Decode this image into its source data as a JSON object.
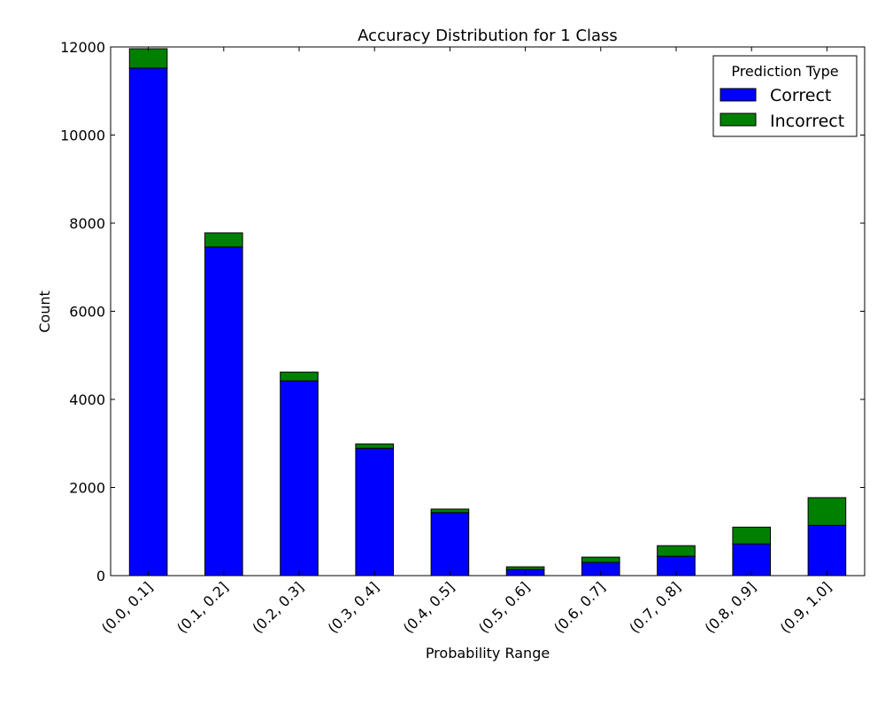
{
  "chart_data": {
    "type": "bar",
    "stacked": true,
    "title": "Accuracy Distribution for 1 Class",
    "xlabel": "Probability Range",
    "ylabel": "Count",
    "ylim": [
      0,
      12000
    ],
    "yticks": [
      0,
      2000,
      4000,
      6000,
      8000,
      10000,
      12000
    ],
    "categories": [
      "(0.0, 0.1]",
      "(0.1, 0.2]",
      "(0.2, 0.3]",
      "(0.3, 0.4]",
      "(0.4, 0.5]",
      "(0.5, 0.6]",
      "(0.6, 0.7]",
      "(0.7, 0.8]",
      "(0.8, 0.9]",
      "(0.9, 1.0]"
    ],
    "series": [
      {
        "name": "Correct",
        "color": "#0000ff",
        "values": [
          11520,
          7460,
          4420,
          2890,
          1430,
          140,
          300,
          440,
          720,
          1140
        ]
      },
      {
        "name": "Incorrect",
        "color": "#008000",
        "values": [
          440,
          320,
          200,
          100,
          80,
          60,
          120,
          240,
          380,
          630
        ]
      }
    ],
    "legend": {
      "title": "Prediction Type",
      "position": "top-right"
    },
    "grid": false
  }
}
